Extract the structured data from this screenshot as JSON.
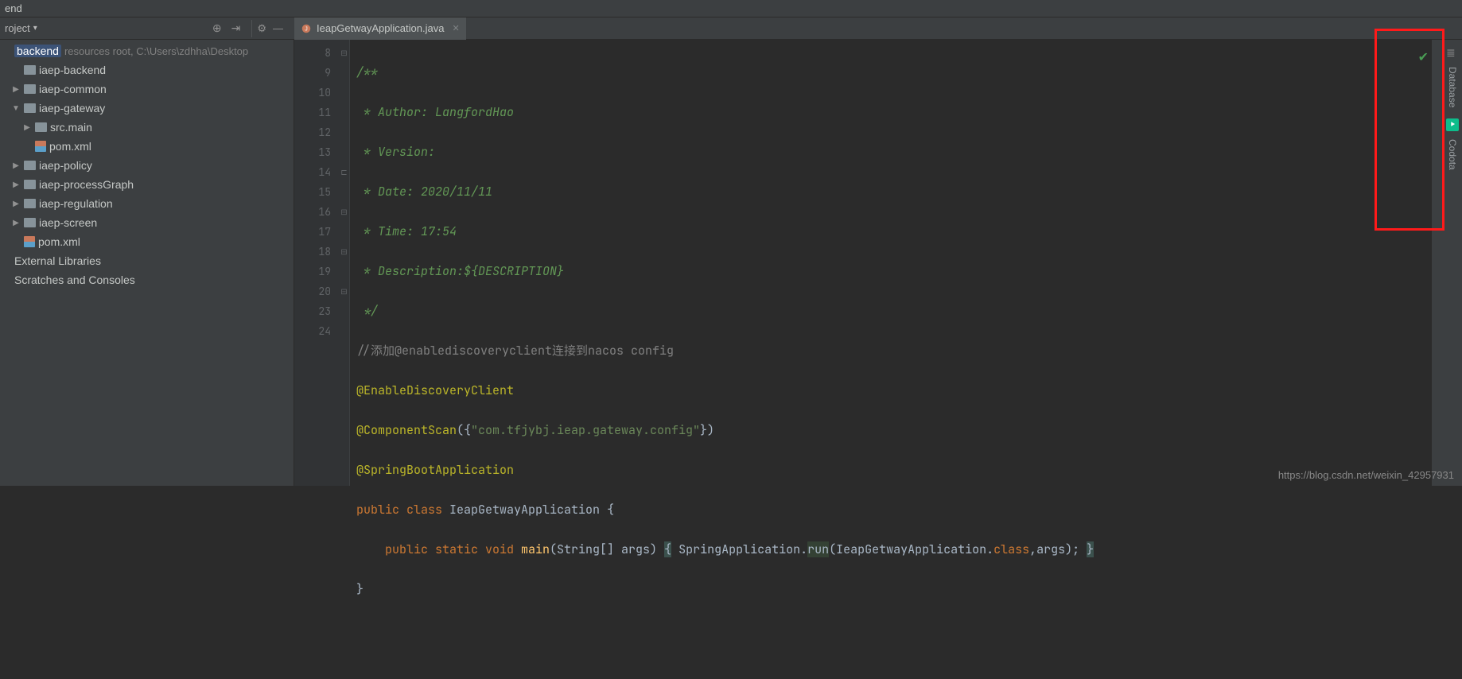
{
  "topbar": {
    "title": "end"
  },
  "sidebar_header": {
    "label": "roject",
    "dropdown": "▾"
  },
  "tab": {
    "filename": "IeapGetwayApplication.java"
  },
  "tree": {
    "root": {
      "name": "backend",
      "suffix": "resources root,  C:\\Users\\zdhha\\Desktop"
    },
    "items": [
      {
        "indent": "l1",
        "arrow": "blank",
        "icon": "folder",
        "label": "iaep-backend"
      },
      {
        "indent": "l1",
        "arrow": "right",
        "icon": "folder",
        "label": "iaep-common"
      },
      {
        "indent": "l1",
        "arrow": "down",
        "icon": "folder",
        "label": "iaep-gateway"
      },
      {
        "indent": "l2",
        "arrow": "right",
        "icon": "folder",
        "label": "src.main"
      },
      {
        "indent": "l2",
        "arrow": "blank",
        "icon": "xml",
        "label": "pom.xml"
      },
      {
        "indent": "l1",
        "arrow": "right",
        "icon": "folder",
        "label": "iaep-policy"
      },
      {
        "indent": "l1",
        "arrow": "right",
        "icon": "folder",
        "label": "iaep-processGraph"
      },
      {
        "indent": "l1",
        "arrow": "right",
        "icon": "folder",
        "label": "iaep-regulation"
      },
      {
        "indent": "l1",
        "arrow": "right",
        "icon": "folder",
        "label": "iaep-screen"
      },
      {
        "indent": "l1",
        "arrow": "blank",
        "icon": "xml",
        "label": "pom.xml"
      }
    ],
    "external": "External Libraries",
    "scratches": "Scratches and Consoles"
  },
  "gutter_lines": [
    "8",
    "9",
    "10",
    "11",
    "12",
    "13",
    "14",
    "15",
    "16",
    "17",
    "18",
    "19",
    "20",
    "23",
    "24"
  ],
  "code": {
    "l8": "/**",
    "l9": " * Author: LangfordHao",
    "l10": " * Version:",
    "l11": " * Date: 2020/11/11",
    "l12": " * Time: 17:54",
    "l13": " * Description:${DESCRIPTION}",
    "l14": " */",
    "l15_a": "//",
    "l15_b": "添加@enablediscoveryclient连接到nacos config",
    "l16": "@EnableDiscoveryClient",
    "l17_a": "@ComponentScan",
    "l17_b": "({",
    "l17_c": "\"com.tfjybj.ieap.gateway.config\"",
    "l17_d": "})",
    "l18": "@SpringBootApplication",
    "l19_a": "public class ",
    "l19_b": "IeapGetwayApplication ",
    "l19_c": "{",
    "l20_a": "    public static void ",
    "l20_b": "main",
    "l20_c": "(String[] args) ",
    "l20_d": "{",
    "l20_e": " SpringApplication.",
    "l20_f": "run",
    "l20_g": "(IeapGetwayApplication.",
    "l20_h": "class",
    "l20_i": ",args); ",
    "l20_j": "}",
    "l23": "}"
  },
  "right_panel": {
    "database": "Database",
    "codota": "Codota"
  },
  "watermark": "https://blog.csdn.net/weixin_42957931"
}
